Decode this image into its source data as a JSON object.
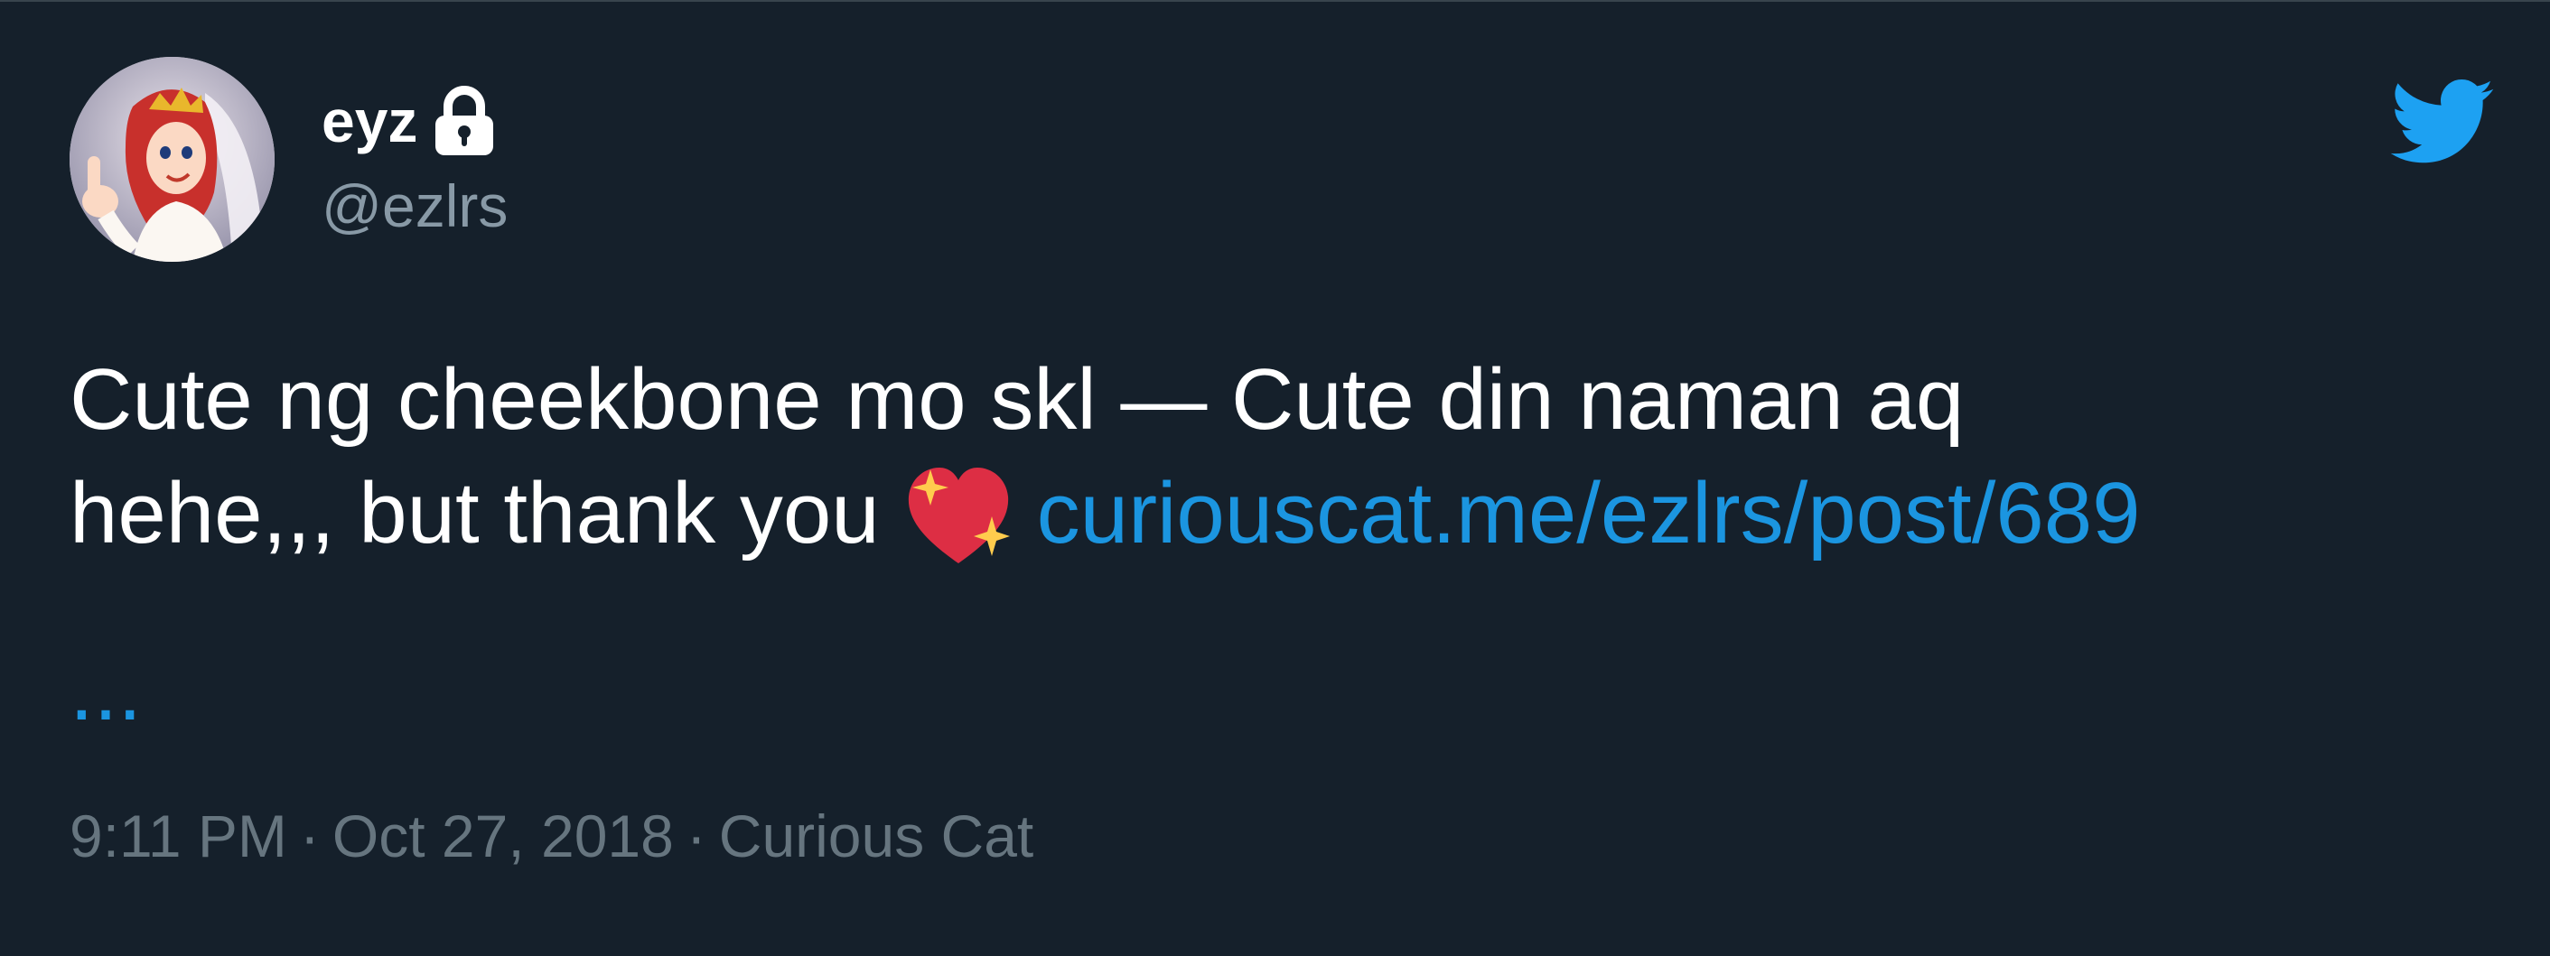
{
  "author": {
    "display_name": "eyz",
    "handle": "@ezlrs",
    "protected_icon": "lock-icon",
    "avatar": "avatar-cartoon-princess"
  },
  "brand": {
    "icon": "twitter-bird-icon",
    "color": "#1da1f2"
  },
  "tweet": {
    "line1": "Cute ng cheekbone mo skl  — Cute din naman aq",
    "line2_text": "hehe,,, but thank you",
    "emoji": "sparkling-heart-icon",
    "link": "curiouscat.me/ezlrs/post/689",
    "ellipsis": "..."
  },
  "meta": {
    "time": "9:11 PM",
    "separator": "·",
    "date": "Oct 27, 2018",
    "source": "Curious Cat"
  },
  "colors": {
    "background": "#15202b",
    "text": "#ffffff",
    "secondary": "#8899a6",
    "link": "#1b95e0"
  }
}
